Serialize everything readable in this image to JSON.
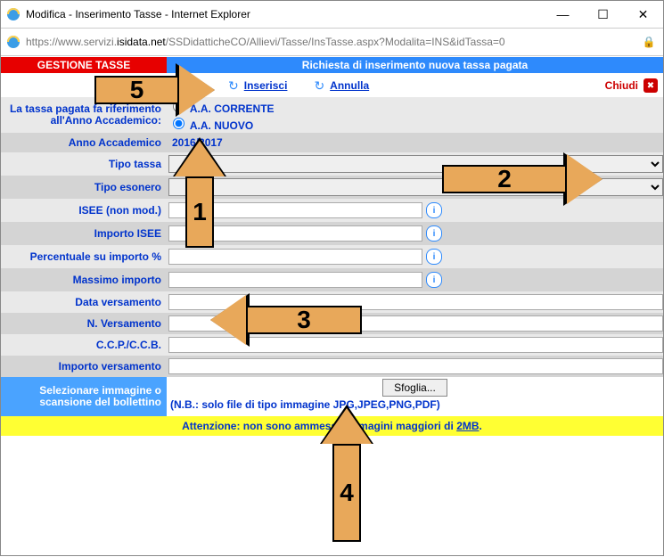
{
  "window": {
    "title": "Modifica - Inserimento Tasse - Internet Explorer",
    "min": "—",
    "max": "☐",
    "close": "✕"
  },
  "url": {
    "protocol": "https://",
    "sub": "www.servizi.",
    "host": "isidata.net",
    "path": "/SSDidatticheCO/Allievi/Tasse/InsTasse.aspx?Modalita=INS&idTassa=0"
  },
  "header": {
    "red": "GESTIONE TASSE",
    "blue": "Richiesta di inserimento nuova tassa pagata"
  },
  "toplinks": {
    "insert": "Inserisci",
    "cancel": "Annulla",
    "close": "Chiudi"
  },
  "labels": {
    "aa_ref": "La tassa pagata fa riferimento all'Anno Accademico:",
    "aa_corrente": "A.A. CORRENTE",
    "aa_nuovo": "A.A. NUOVO",
    "anno_accademico": "Anno Accademico",
    "tipo_tassa": "Tipo tassa",
    "tipo_esonero": "Tipo esonero",
    "isee": "ISEE (non mod.)",
    "importo_isee": "Importo ISEE",
    "percentuale": "Percentuale su importo %",
    "massimo": "Massimo importo",
    "data_vers": "Data versamento",
    "n_vers": "N. Versamento",
    "ccp": "C.C.P./C.C.B.",
    "importo_vers": "Importo versamento",
    "selezionare": "Selezionare immagine o scansione del bollettino",
    "sfoglia": "Sfoglia...",
    "file_note": "(N.B.: solo file di tipo immagine JPG,JPEG,PNG,PDF)"
  },
  "values": {
    "anno_accademico": "2016/2017"
  },
  "warning": {
    "prefix": "Attenzione: non sono ammesse immagini maggiori di ",
    "link": "2MB",
    "suffix": "."
  },
  "annotations": {
    "n1": "1",
    "n2": "2",
    "n3": "3",
    "n4": "4",
    "n5": "5"
  }
}
